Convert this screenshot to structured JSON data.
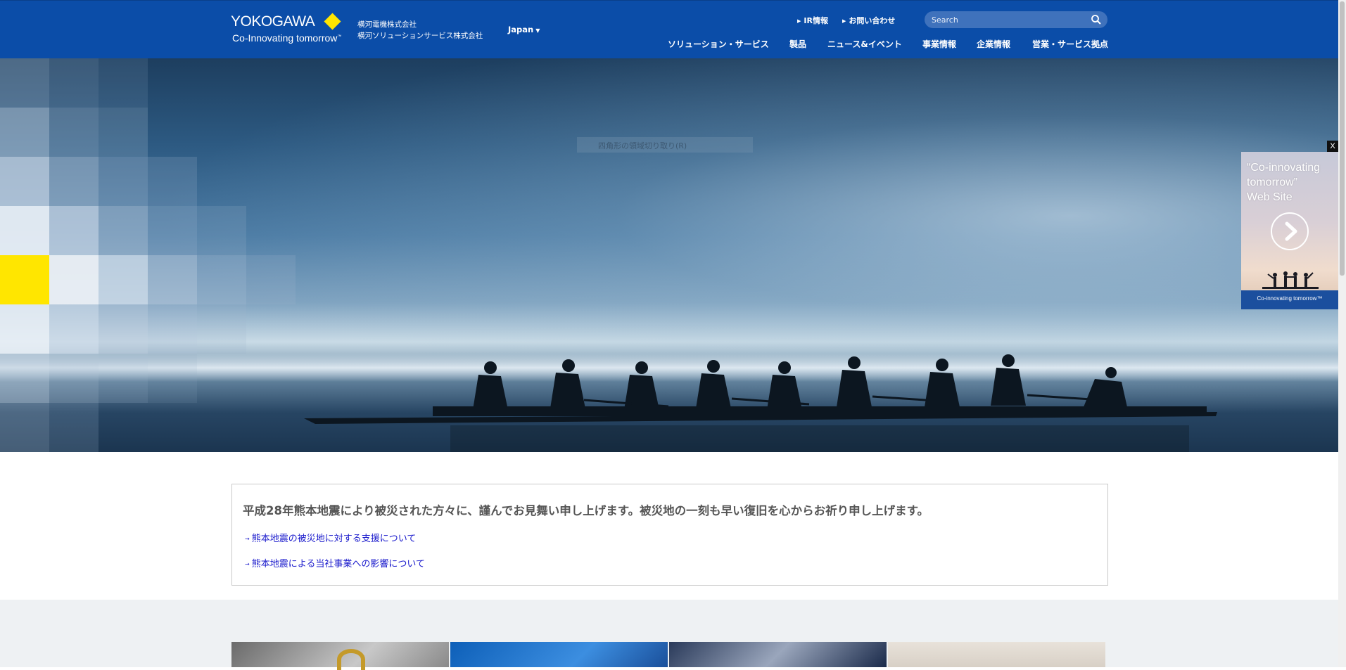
{
  "header": {
    "logo_text": "YOKOGAWA",
    "tagline": "Co-Innovating tomorrow",
    "tagline_mark": "™",
    "companies": [
      "横河電機株式会社",
      "横河ソリューションサービス株式会社"
    ],
    "region": "Japan",
    "utility_links": [
      "IR情報",
      "お問い合わせ"
    ],
    "search_placeholder": "Search",
    "nav": [
      "ソリューション・サービス",
      "製品",
      "ニュース&イベント",
      "事業情報",
      "企業情報",
      "営業・サービス拠点"
    ],
    "colors": {
      "bar": "#0b4da8",
      "logo_mark": "#ffe600"
    }
  },
  "hero": {
    "ghost_tooltip": "四角形の領域切り取り(R)"
  },
  "side_banner": {
    "close_label": "X",
    "title_lines": [
      "“Co-innovating",
      " tomorrow”",
      " Web Site"
    ],
    "footer": "Co-innovating tomorrow™",
    "arrow_icon": "chevron-right-icon"
  },
  "notice": {
    "title": "平成28年熊本地震により被災された方々に、謹んでお見舞い申し上げます。被災地の一刻も早い復旧を心からお祈り申し上げます。",
    "links": [
      "熊本地震の被災地に対する支援について",
      "熊本地震による当社事業への影響について"
    ]
  }
}
